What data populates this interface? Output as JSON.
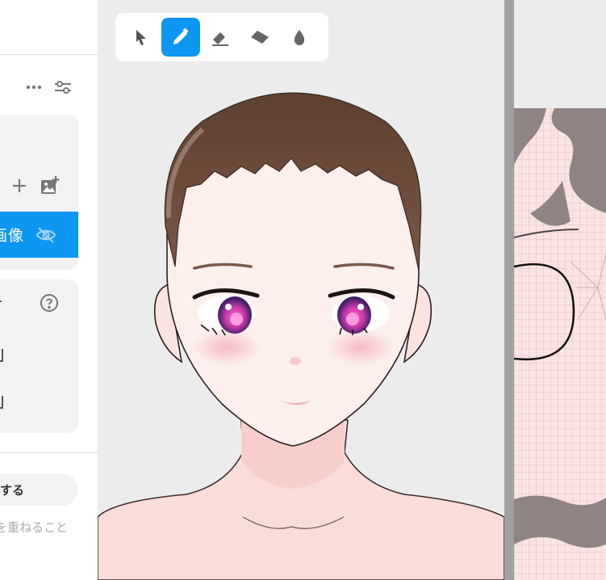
{
  "layers_panel": {
    "more_icon": "more-horizontal-icon",
    "settings_icon": "sliders-icon",
    "add_icon": "plus-icon",
    "add_image_icon": "add-image-icon",
    "selected_layer_label": "画像",
    "visibility_icon": "eye-off-icon",
    "help_icon": "help-circle-icon",
    "apply_button_label": "する",
    "hint_text": "を重ねること"
  },
  "toolbar": {
    "tools": [
      {
        "name": "select",
        "icon": "cursor-icon",
        "active": false
      },
      {
        "name": "pen",
        "icon": "pencil-icon",
        "active": true
      },
      {
        "name": "eraser",
        "icon": "eraser-icon",
        "active": false
      },
      {
        "name": "fill",
        "icon": "fill-icon",
        "active": false
      },
      {
        "name": "dropper",
        "icon": "drop-icon",
        "active": false
      }
    ]
  },
  "colors": {
    "accent": "#0d96f2",
    "hair": "#6b4a39",
    "skin": "#fbe9e6",
    "canvas_bg": "#ececec",
    "uv_bg": "#fbe3e1",
    "uv_dark": "#8f8483"
  }
}
